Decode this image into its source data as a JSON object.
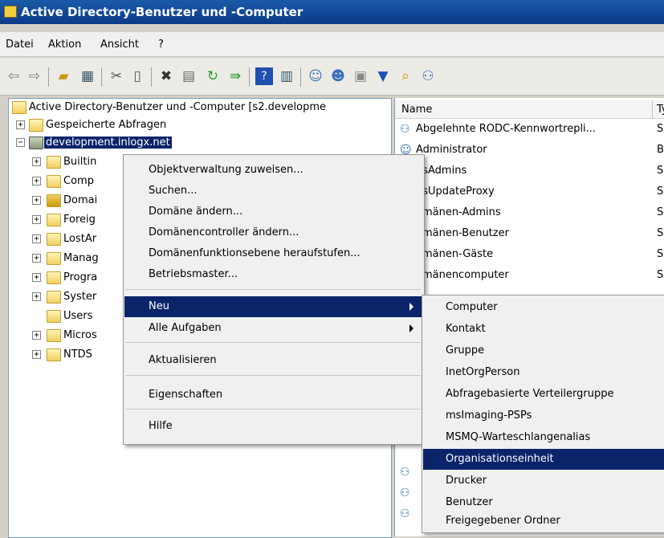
{
  "window": {
    "title": "Active Directory-Benutzer und -Computer"
  },
  "menubar": [
    "Datei",
    "Aktion",
    "Ansicht",
    "?"
  ],
  "toolbar": {
    "icons": [
      "back-arrow-icon",
      "forward-arrow-icon",
      "up-folder-icon",
      "show-hide-tree-icon",
      "cut-icon",
      "copy-icon",
      "delete-icon",
      "properties-icon",
      "refresh-icon",
      "export-list-icon",
      "help-icon",
      "show-hide-action-pane-icon",
      "new-user-icon",
      "new-group-icon",
      "new-ou-icon",
      "filter-icon",
      "find-icon",
      "add-to-group-icon"
    ]
  },
  "tree": {
    "root": "Active Directory-Benutzer und -Computer [s2.developme",
    "saved_queries": "Gespeicherte Abfragen",
    "domain": "development.inlogx.net",
    "children": [
      "Builtin",
      "Comp",
      "Domai",
      "Foreig",
      "LostAr",
      "Manag",
      "Progra",
      "Syster",
      "Users",
      "Micros",
      "NTDS"
    ]
  },
  "list": {
    "columns": {
      "name": "Name",
      "type": "Ty"
    },
    "rows": [
      {
        "name": "Abgelehnte RODC-Kennwortrepli...",
        "type": "Sic"
      },
      {
        "name": "Administrator",
        "type": "Be"
      },
      {
        "name": "nsAdmins",
        "type": "Sic"
      },
      {
        "name": "nsUpdateProxy",
        "type": "Sic"
      },
      {
        "name": "omänen-Admins",
        "type": "Sic"
      },
      {
        "name": "omänen-Benutzer",
        "type": "Sic"
      },
      {
        "name": "omänen-Gäste",
        "type": "Sic"
      },
      {
        "name": "omänencomputer",
        "type": "Sic"
      }
    ]
  },
  "context_menu": {
    "items": [
      "Objektverwaltung zuweisen...",
      "Suchen...",
      "Domäne ändern...",
      "Domänencontroller ändern...",
      "Domänenfunktionsebene heraufstufen...",
      "Betriebsmaster...",
      "Neu",
      "Alle Aufgaben",
      "Aktualisieren",
      "Eigenschaften",
      "Hilfe"
    ],
    "highlighted": "Neu"
  },
  "submenu": {
    "items": [
      "Computer",
      "Kontakt",
      "Gruppe",
      "InetOrgPerson",
      "Abfragebasierte Verteilergruppe",
      "msImaging-PSPs",
      "MSMQ-Warteschlangenalias",
      "Organisationseinheit",
      "Drucker",
      "Benutzer",
      "Freigegebener Ordner"
    ],
    "highlighted": "Organisationseinheit"
  },
  "colors": {
    "selection": "#0a246a",
    "titlebar": "#0a3a8a",
    "menu_bg": "#f0f0f0"
  }
}
